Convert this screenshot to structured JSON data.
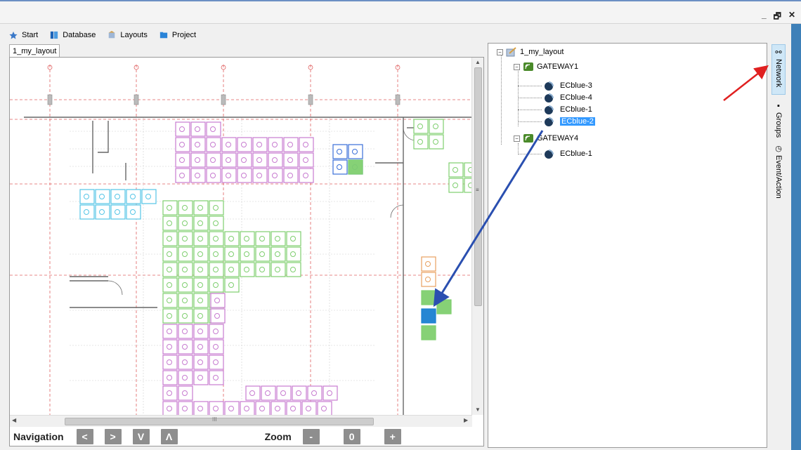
{
  "window": {
    "minimize_label": "_",
    "restore_label": "🗗",
    "close_label": "✕"
  },
  "toolbar": {
    "start": "Start",
    "database": "Database",
    "layouts": "Layouts",
    "project": "Project"
  },
  "document_tab": "1_my_layout",
  "navigation": {
    "label": "Navigation",
    "left": "<",
    "right": ">",
    "down": "V",
    "up": "Λ"
  },
  "zoom": {
    "label": "Zoom",
    "minus": "-",
    "reset": "0",
    "plus": "+"
  },
  "scroll": {
    "up": "▲",
    "down": "▼",
    "left": "◀",
    "right": "▶",
    "v_grip": "≡",
    "h_grip": "III"
  },
  "tree": {
    "root": "1_my_layout",
    "gateways": [
      {
        "label": "GATEWAY1",
        "devices": [
          "ECblue-3",
          "ECblue-4",
          "ECblue-1",
          "ECblue-2"
        ]
      },
      {
        "label": "GATEWAY4",
        "devices": [
          "ECblue-1"
        ]
      }
    ],
    "selected_device": "ECblue-2"
  },
  "side_tabs": {
    "network": "Network",
    "groups": "Groups",
    "event_action": "Event/Action"
  },
  "colors": {
    "purple": "#c77bd0",
    "green": "#7fcf6f",
    "blue": "#3a6fd8",
    "cyan": "#55c5e6",
    "orange": "#e8a060",
    "selected_tile": "#1a7fd1",
    "red_arrow": "#e02020",
    "blue_arrow": "#2a4fb0"
  }
}
